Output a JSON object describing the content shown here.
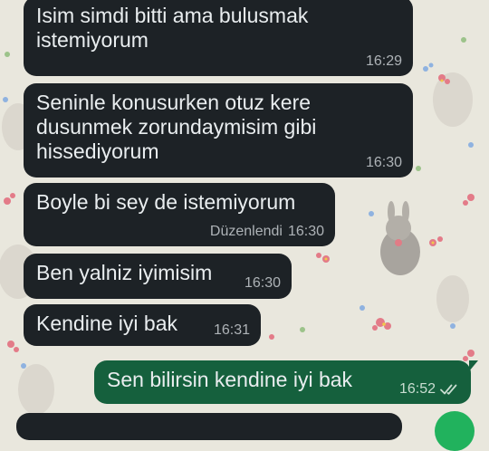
{
  "messages": [
    {
      "text": "Isim simdi bitti ama bulusmak\nistemiyorum",
      "time": "16:29",
      "direction": "incoming"
    },
    {
      "text": "Seninle konusurken otuz kere\ndusunmek zorundaymisim gibi\nhissediyorum",
      "time": "16:30",
      "direction": "incoming"
    },
    {
      "text": "Boyle bi sey de istemiyorum",
      "edited": "Düzenlendi",
      "time": "16:30",
      "direction": "incoming"
    },
    {
      "text": "Ben yalniz iyimisim",
      "time": "16:30",
      "direction": "incoming"
    },
    {
      "text": "Kendine iyi bak",
      "time": "16:31",
      "direction": "incoming"
    },
    {
      "text": "Sen bilirsin kendine iyi bak",
      "time": "16:52",
      "direction": "outgoing",
      "status_icon": "double-check-icon"
    }
  ],
  "colors": {
    "incoming_bubble": "#1d2226",
    "outgoing_bubble": "#15603d",
    "message_text": "#e9edef",
    "wallpaper": "#e9e7dd",
    "fab": "#21b25d"
  }
}
